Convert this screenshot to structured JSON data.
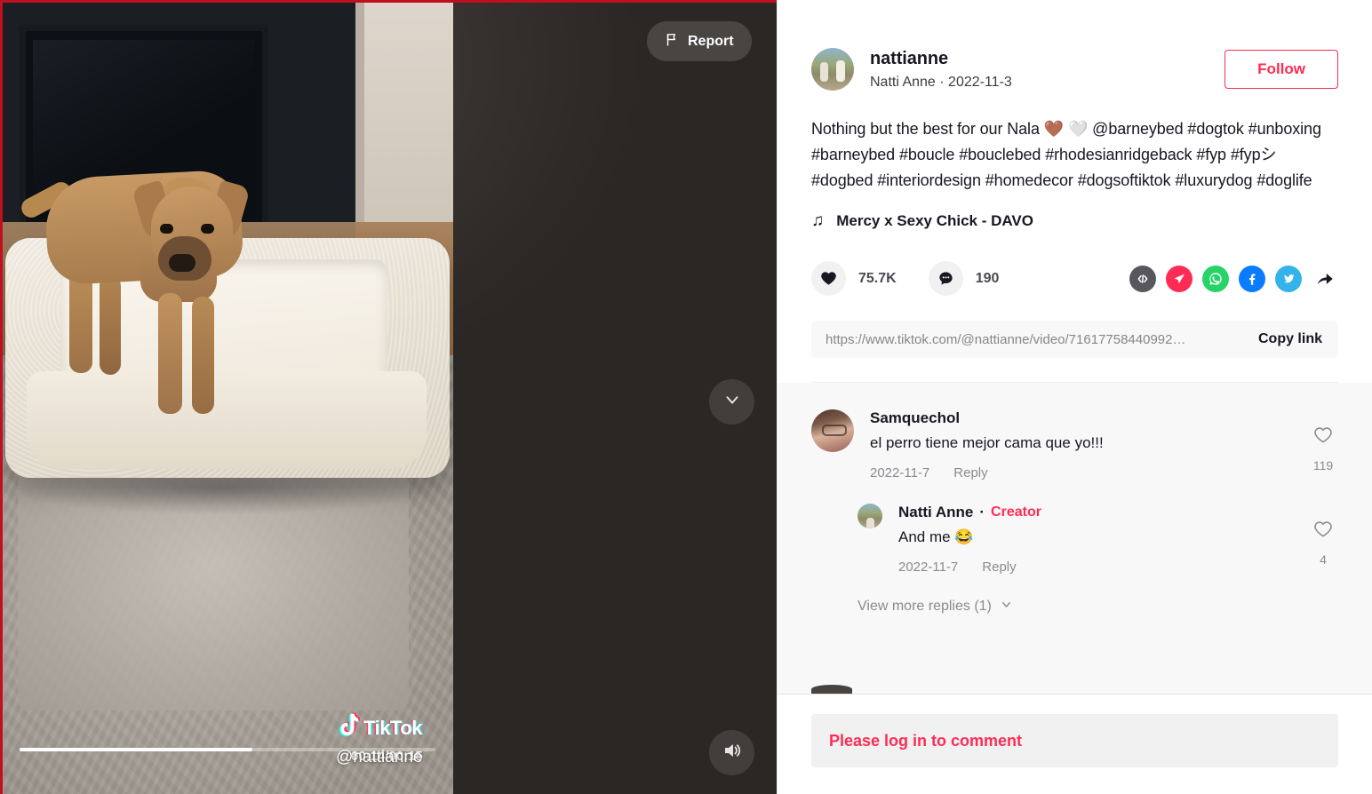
{
  "video": {
    "report_label": "Report",
    "report_icon": "flag-icon",
    "time_label": "00:14/00:15",
    "progress_percent": 56,
    "watermark_text": "TikTok",
    "watermark_handle": "@nattianne",
    "sound_icon": "speaker-on-icon",
    "next_icon": "chevron-down-icon"
  },
  "author": {
    "username": "nattianne",
    "display_name_and_date": "Natti Anne · 2022-11-3",
    "follow_label": "Follow",
    "avatar_name": "author-avatar"
  },
  "post": {
    "caption": "Nothing but the best for our Nala 🤎 🤍 @barneybed #dogtok #unboxing #barneybed #boucle #bouclebed #rhodesianridgeback #fyp #fypシ #dogbed #interiordesign #homedecor #dogsoftiktok #luxurydog #doglife",
    "music_note": "♫",
    "music_title": "Mercy x Sexy Chick - DAVO"
  },
  "stats": {
    "likes": "75.7K",
    "comments": "190",
    "like_icon": "heart-icon",
    "comment_icon": "comment-bubble-icon"
  },
  "share": {
    "icons": [
      {
        "name": "embed-code-icon",
        "glyph": "</>",
        "color": "#58585c"
      },
      {
        "name": "send-to-friends-icon",
        "glyph": "➤",
        "color": "#fe2c55"
      },
      {
        "name": "whatsapp-icon",
        "glyph": "✆",
        "color": "#25d366"
      },
      {
        "name": "facebook-icon",
        "glyph": "f",
        "color": "#0a7cff"
      },
      {
        "name": "twitter-icon",
        "glyph": "🐦",
        "color": "#32b3ea"
      },
      {
        "name": "share-arrow-icon",
        "glyph": "➦",
        "color": "#161823"
      }
    ]
  },
  "copy": {
    "url": "https://www.tiktok.com/@nattianne/video/71617758440992…",
    "button_label": "Copy link"
  },
  "comments": [
    {
      "name": "Samquechol",
      "is_creator": false,
      "creator_label": "",
      "text": "el perro tiene mejor cama que yo!!!",
      "date": "2022-11-7",
      "reply_label": "Reply",
      "likes": "119"
    },
    {
      "name": "Natti Anne",
      "is_creator": true,
      "creator_label": "Creator",
      "separator": "·",
      "text": "And me 😂",
      "date": "2022-11-7",
      "reply_label": "Reply",
      "likes": "4"
    }
  ],
  "view_more_replies": "View more replies (1)",
  "login": {
    "message": "Please log in to comment"
  },
  "colors": {
    "accent": "#fe2c55",
    "text": "#161823",
    "muted": "#8a8b91",
    "panel": "#f8f8f8"
  }
}
